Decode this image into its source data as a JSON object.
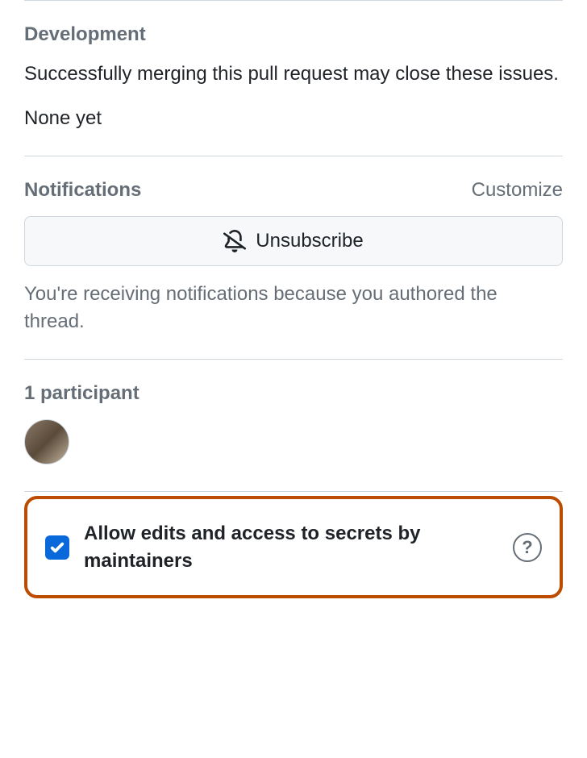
{
  "development": {
    "title": "Development",
    "description": "Successfully merging this pull request may close these issues.",
    "empty_state": "None yet"
  },
  "notifications": {
    "title": "Notifications",
    "customize_label": "Customize",
    "unsubscribe_label": "Unsubscribe",
    "reason_text": "You're receiving notifications because you authored the thread."
  },
  "participants": {
    "title": "1 participant"
  },
  "maintainer_edits": {
    "label": "Allow edits and access to secrets by maintainers",
    "help_text": "?"
  }
}
